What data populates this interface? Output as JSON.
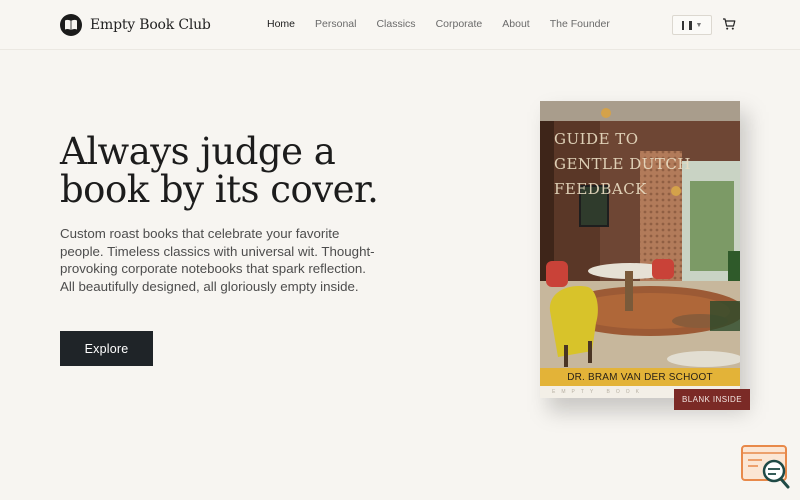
{
  "header": {
    "brand": "Empty Book Club",
    "logo_icon": "book-icon",
    "nav": [
      {
        "label": "Home",
        "active": true
      },
      {
        "label": "Personal",
        "active": false
      },
      {
        "label": "Classics",
        "active": false
      },
      {
        "label": "Corporate",
        "active": false
      },
      {
        "label": "About",
        "active": false
      },
      {
        "label": "The Founder",
        "active": false
      }
    ],
    "language_icon": "flag-icon",
    "cart_icon": "cart-icon"
  },
  "hero": {
    "headline": "Always judge a\nbook by its cover.",
    "description": "Custom roast books that celebrate your favorite people. Timeless classics with universal wit. Thought-provoking corporate notebooks that spark reflection. All beautifully designed, all gloriously empty inside.",
    "cta_label": "Explore"
  },
  "book": {
    "title": "GUIDE TO\nGENTLE DUTCH\nFEEDBACK",
    "author": "DR. BRAM VAN DER SCHOOT",
    "publisher": "EMPTY BOOK",
    "badge": "BLANK INSIDE"
  },
  "colors": {
    "background": "#f7f5f1",
    "button": "#1f2428",
    "author_band": "#e3b338",
    "badge": "#7b2a26"
  },
  "widget_icon": "search-chat-icon"
}
